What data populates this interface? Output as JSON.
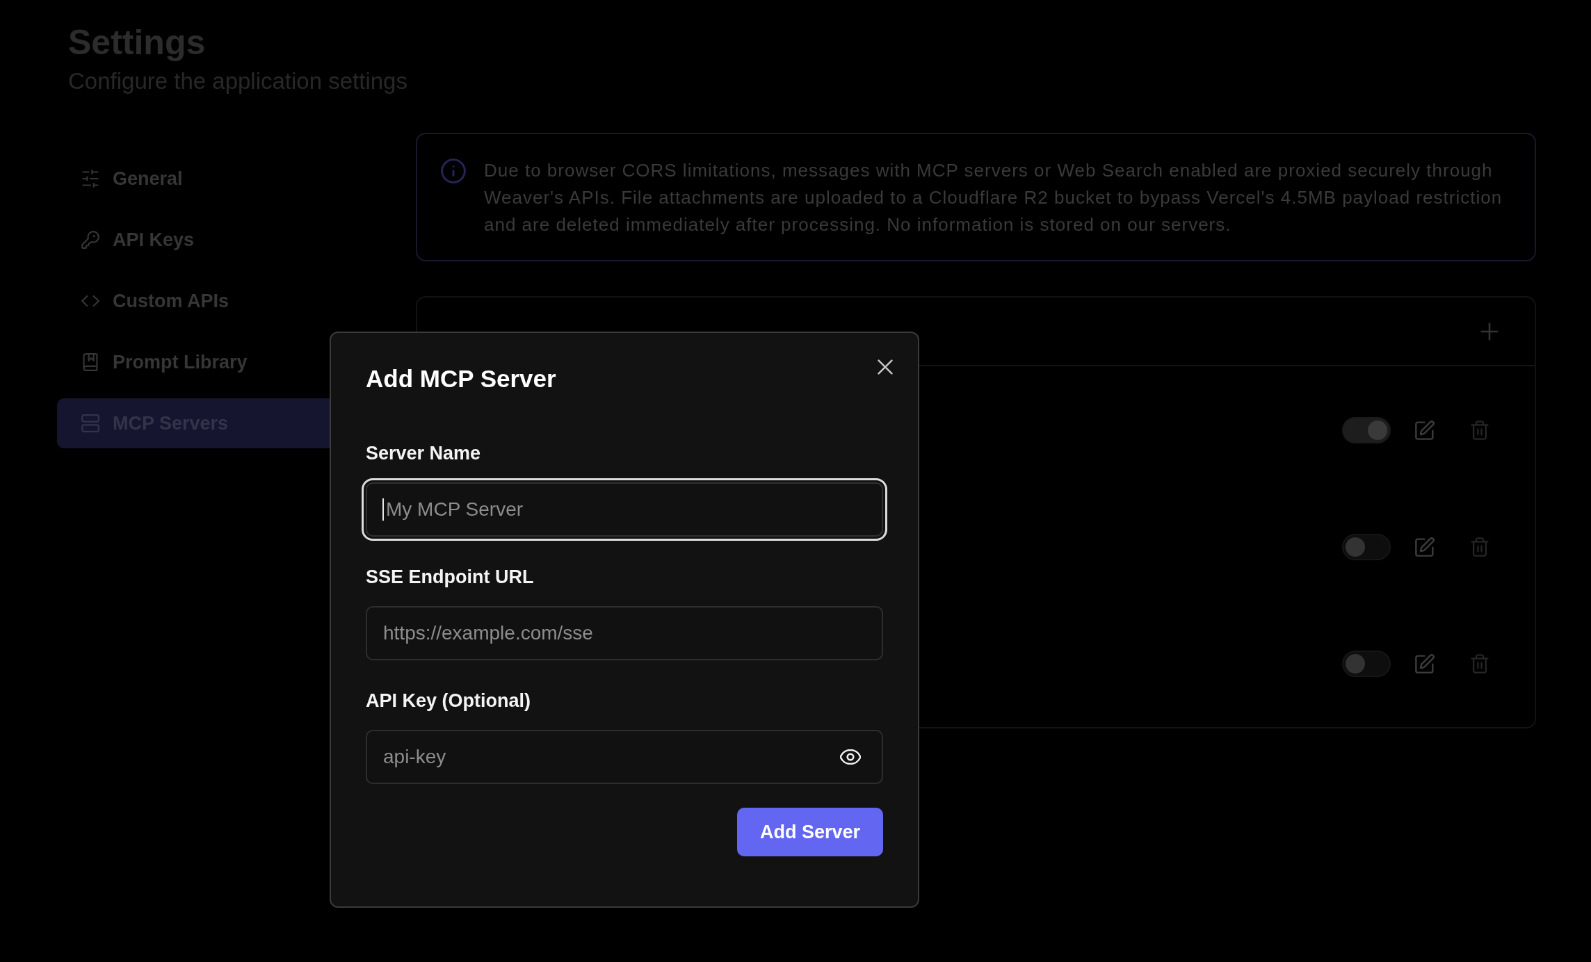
{
  "header": {
    "title": "Settings",
    "subtitle": "Configure the application settings"
  },
  "sidebar": {
    "items": [
      {
        "label": "General",
        "selected": false
      },
      {
        "label": "API Keys",
        "selected": false
      },
      {
        "label": "Custom APIs",
        "selected": false
      },
      {
        "label": "Prompt Library",
        "selected": false
      },
      {
        "label": "MCP Servers",
        "selected": true
      }
    ]
  },
  "notice": {
    "text": "Due to browser CORS limitations, messages with MCP servers or Web Search enabled are proxied securely through Weaver's APIs. File attachments are uploaded to a Cloudflare R2 bucket to bypass Vercel's 4.5MB payload restriction and are deleted immediately after processing. No information is stored on our servers."
  },
  "mcp_servers": {
    "rows": [
      {
        "on": true
      },
      {
        "on": false
      },
      {
        "on": false
      }
    ]
  },
  "dialog": {
    "title": "Add MCP Server",
    "fields": [
      {
        "label": "Server Name",
        "placeholder": "My MCP Server",
        "kind": "text",
        "focused": true
      },
      {
        "label": "SSE Endpoint URL",
        "placeholder": "https://example.com/sse",
        "kind": "text",
        "focused": false
      },
      {
        "label": "API Key (Optional)",
        "placeholder": "api-key",
        "kind": "secret",
        "focused": false
      }
    ],
    "submit": "Add Server"
  }
}
